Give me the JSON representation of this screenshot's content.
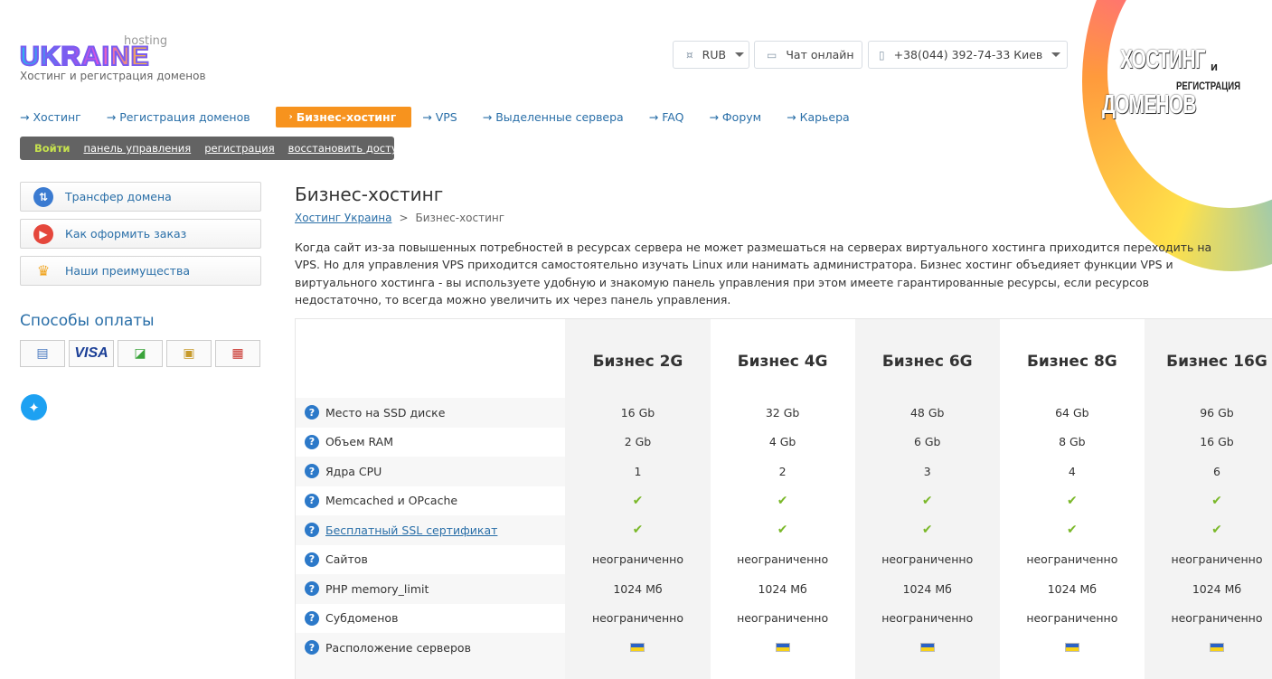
{
  "logo": {
    "word": "UKRAINE",
    "hosting": "hosting",
    "tagline": "Хостинг и регистрация доменов"
  },
  "header": {
    "currency": "RUB",
    "chat": "Чат онлайн",
    "phone": "+38(044) 392-74-33 Киев"
  },
  "promo": {
    "line1": "ХОСТИНГ",
    "line2": "и",
    "line3": "РЕГИСТРАЦИЯ",
    "line4": "ДОМЕНОВ"
  },
  "nav": {
    "items": [
      "Хостинг",
      "Регистрация доменов",
      "Бизнес-хостинг",
      "VPS",
      "Выделенные сервера",
      "FAQ",
      "Форум",
      "Карьера"
    ]
  },
  "auth": {
    "login": "Войти",
    "panel": "панель управления",
    "register": "регистрация",
    "restore": "восстановить доступ"
  },
  "sidebar": {
    "buttons": [
      "Трансфер домена",
      "Как оформить заказ",
      "Наши преимущества"
    ],
    "payment_title": "Способы оплаты",
    "visa": "VISA"
  },
  "colors": {
    "accent": "#f7931e",
    "link": "#2a6fa8",
    "check": "#7ab829",
    "question": "#2c79c9"
  },
  "page": {
    "title": "Бизнес-хостинг",
    "breadcrumb_home": "Хостинг Украина",
    "breadcrumb_sep": ">",
    "breadcrumb_current": "Бизнес-хостинг",
    "intro": "Когда сайт из-за повышенных потребностей в ресурсах сервера не может размешаться на серверах виртуального хостинга приходится переходить на VPS. Но для управления VPS приходится самостоятельно изучать Linux или нанимать администратора. Бизнес хостинг объедияет функции VPS и виртуального хостинга - вы используете удобную и знакомую панель управления при этом имеете гарантированные ресурсы, если ресурсов недостаточно, то всегда можно увеличить их через панель управления."
  },
  "table": {
    "plans": [
      "Бизнес 2G",
      "Бизнес 4G",
      "Бизнес 6G",
      "Бизнес 8G",
      "Бизнес 16G"
    ],
    "rows": [
      {
        "label": "Место на SSD диске",
        "values": [
          "16 Gb",
          "32 Gb",
          "48 Gb",
          "64 Gb",
          "96 Gb"
        ]
      },
      {
        "label": "Объем RAM",
        "values": [
          "2 Gb",
          "4 Gb",
          "6 Gb",
          "8 Gb",
          "16 Gb"
        ]
      },
      {
        "label": "Ядра CPU",
        "values": [
          "1",
          "2",
          "3",
          "4",
          "6"
        ]
      },
      {
        "label": "Memcached и OPcache",
        "values": [
          "✔",
          "✔",
          "✔",
          "✔",
          "✔"
        ]
      },
      {
        "label": "Бесплатный SSL сертификат",
        "link": true,
        "values": [
          "✔",
          "✔",
          "✔",
          "✔",
          "✔"
        ]
      },
      {
        "label": "Сайтов",
        "values": [
          "неограниченно",
          "неограниченно",
          "неограниченно",
          "неограниченно",
          "неограниченно"
        ]
      },
      {
        "label": "PHP memory_limit",
        "values": [
          "1024 Мб",
          "1024 Мб",
          "1024 Мб",
          "1024 Мб",
          "1024 Мб"
        ]
      },
      {
        "label": "Субдоменов",
        "values": [
          "неограниченно",
          "неограниченно",
          "неограниченно",
          "неограниченно",
          "неограниченно"
        ]
      },
      {
        "label": "Расположение серверов",
        "values": [
          "ukraine-flag",
          "ukraine-flag",
          "ukraine-flag",
          "ukraine-flag",
          "ukraine-flag"
        ]
      }
    ]
  }
}
